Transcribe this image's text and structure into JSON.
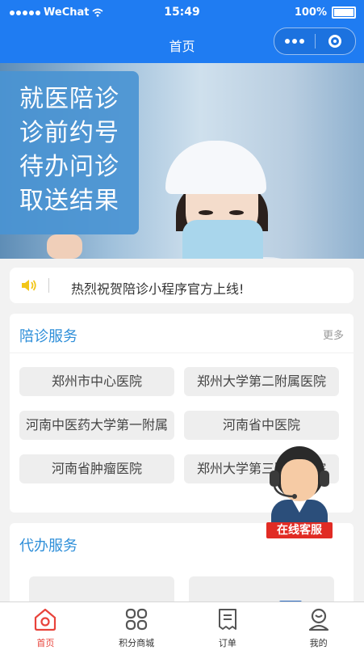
{
  "status_bar": {
    "carrier": "WeChat",
    "time": "15:49",
    "battery": "100%"
  },
  "nav": {
    "title": "首页"
  },
  "banner": {
    "lines": [
      "就医陪诊",
      "诊前约号",
      "待办问诊",
      "取送结果"
    ]
  },
  "notice": {
    "text": "热烈祝贺陪诊小程序官方上线!"
  },
  "escort_service": {
    "title": "陪诊服务",
    "more": "更多",
    "hospitals": [
      "郑州市中心医院",
      "郑州大学第二附属医院",
      "河南中医药大学第一附属",
      "河南省中医院",
      "河南省肿瘤医院",
      "郑州大学第三附属医院"
    ]
  },
  "errand_service": {
    "title": "代办服务"
  },
  "customer_service": {
    "label": "在线客服"
  },
  "tabbar": {
    "items": [
      "首页",
      "积分商城",
      "订单",
      "我的"
    ]
  },
  "colors": {
    "primary": "#1f7cf2",
    "title_blue": "#2f8fd9",
    "active_red": "#e8433b"
  }
}
